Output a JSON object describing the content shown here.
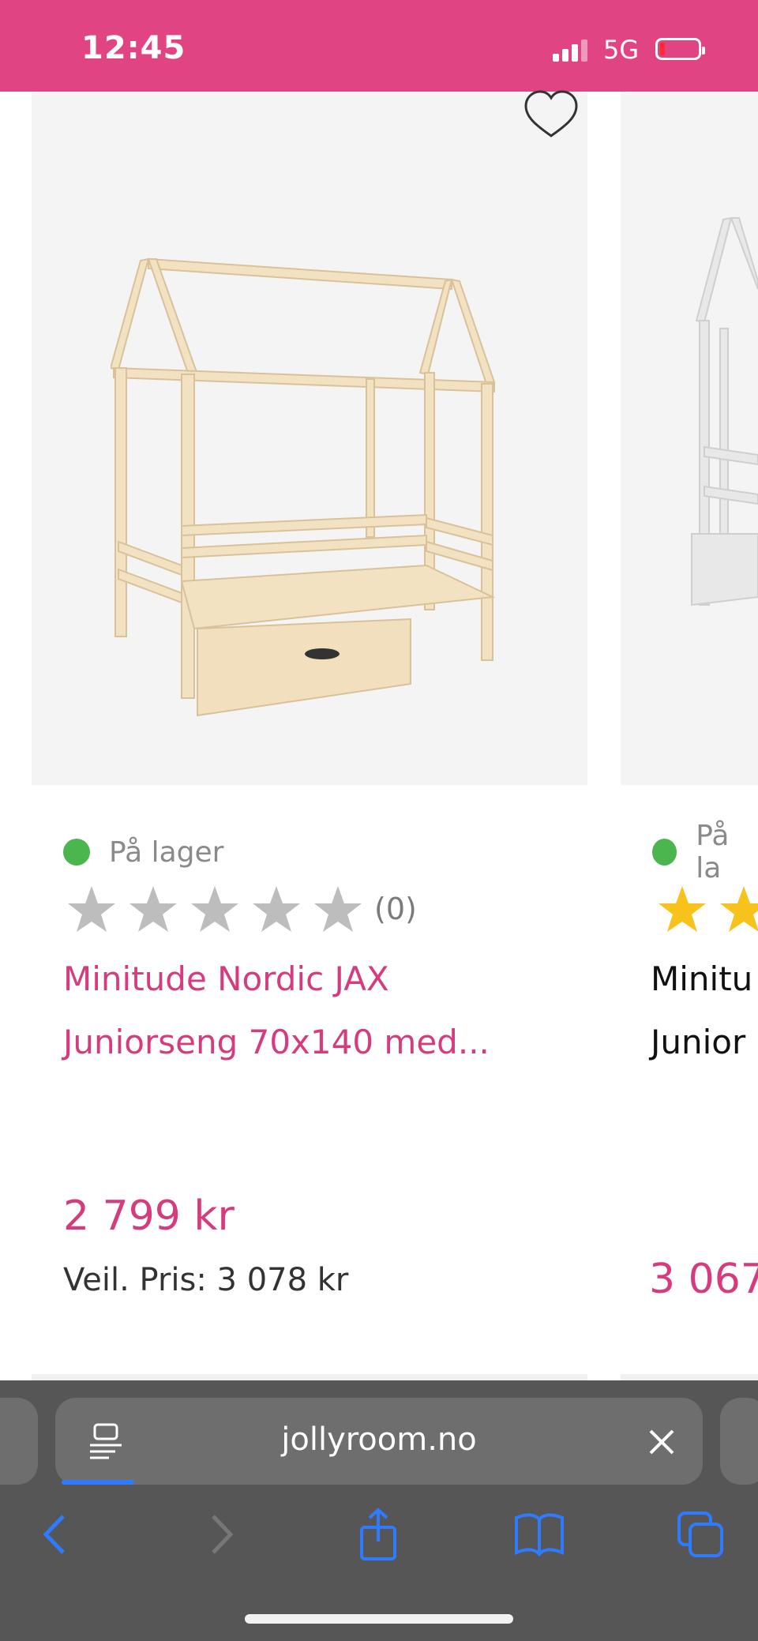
{
  "status_bar": {
    "time": "12:45",
    "network": "5G",
    "color": "#e14483"
  },
  "product": {
    "stock": "På lager",
    "rating_count": "(0)",
    "rating_value": 0,
    "title_line1": "Minitude Nordic JAX",
    "title_line2": "Juniorseng 70x140 med...",
    "price": "2 799 kr",
    "recommended_price": "Veil. Pris: 3 078 kr",
    "accent_color": "#d63b7d"
  },
  "product_2": {
    "stock": "På la",
    "title_line1": "Minitu",
    "title_line2": "Junior",
    "price": "3 067"
  },
  "browser": {
    "url": "jollyroom.no"
  }
}
